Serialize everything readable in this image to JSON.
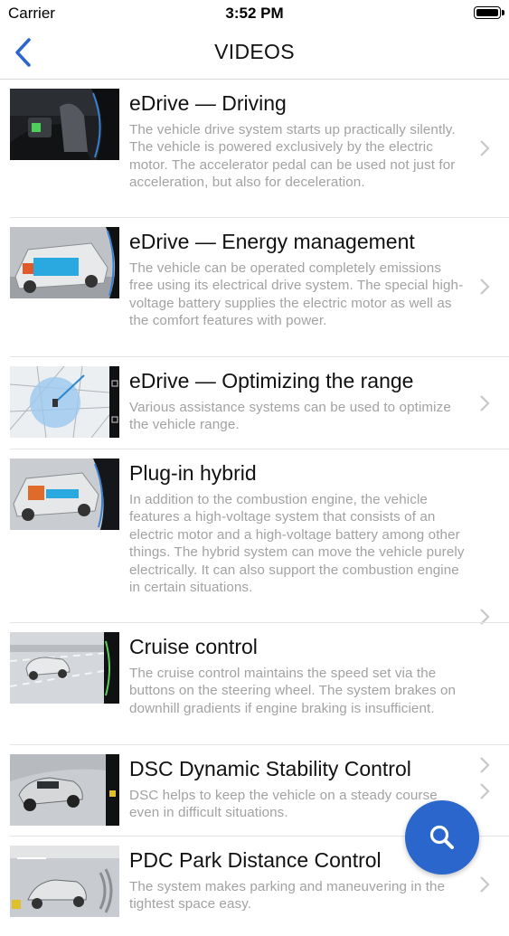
{
  "status_bar": {
    "carrier": "Carrier",
    "time": "3:52 PM"
  },
  "nav": {
    "title": "VIDEOS",
    "back_icon": "chevron-left-icon"
  },
  "videos": [
    {
      "title": "eDrive — Driving",
      "description": "The vehicle drive system starts up practically silently. The vehicle is powered exclusively by the electric motor. The accelerator pedal can be used not just for acceleration, but also for deceleration."
    },
    {
      "title": "eDrive — Energy management",
      "description": "The vehicle can be operated completely emissions free using its electrical drive system. The special high-voltage battery supplies the electric motor as well as the comfort features with power."
    },
    {
      "title": "eDrive — Optimizing the range",
      "description": "Various assistance systems can be used to optimize the vehicle range."
    },
    {
      "title": "Plug-in hybrid",
      "description": "In addition to the combustion engine, the vehicle features a high-voltage system that consists of an electric motor and a high-voltage battery among other things. The hybrid system can move the vehicle purely electrically. It can also support the combustion engine in certain situations."
    },
    {
      "title": "Cruise control",
      "description": "The cruise control maintains the speed set via the buttons on the steering wheel. The system brakes on downhill gradients if engine braking is insufficient."
    },
    {
      "title": "DSC Dynamic Stability Control",
      "description": "DSC helps to keep the vehicle on a steady course even in difficult situations."
    },
    {
      "title": "PDC Park Distance Control",
      "description": "The system makes parking and maneuvering in the tightest space easy."
    }
  ],
  "fab": {
    "icon": "search-icon",
    "color": "#2a66cc"
  },
  "colors": {
    "accent": "#2a66cc",
    "description_text": "#a2a2a2"
  }
}
